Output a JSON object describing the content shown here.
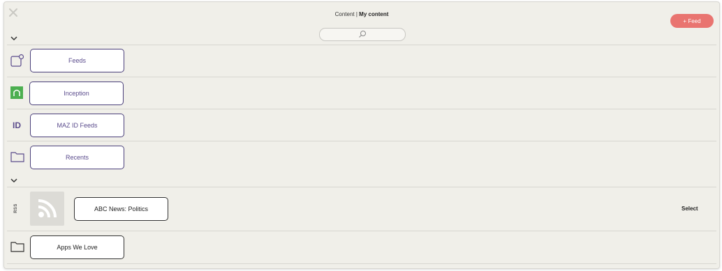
{
  "header": {
    "title_prefix": "Content | ",
    "title_bold": "My content",
    "add_feed_label": "+ Feed"
  },
  "search": {
    "placeholder": ""
  },
  "items": [
    {
      "label": "Feeds",
      "icon": "feed-box-icon"
    },
    {
      "label": "Inception",
      "icon": "inception-logo-icon",
      "icon_color": "#4caf50"
    },
    {
      "label": "MAZ ID Feeds",
      "icon": "id-icon",
      "icon_text": "ID"
    },
    {
      "label": "Recents",
      "icon": "folder-icon"
    }
  ],
  "second_group": [
    {
      "label": "ABC News: Politics",
      "type_label": "RSS",
      "icon": "rss-icon",
      "action": "Select"
    },
    {
      "label": "Apps We Love",
      "icon": "folder-icon"
    }
  ],
  "colors": {
    "accent": "#e97470",
    "brand": "#5a4b8c",
    "background": "#f0efe9"
  }
}
